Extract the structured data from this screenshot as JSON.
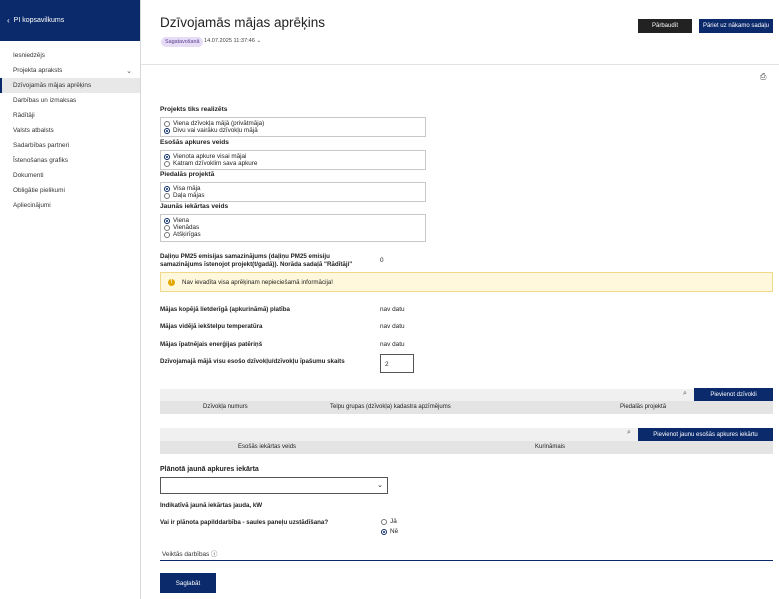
{
  "sidebar": {
    "back_label": "PI kopsavilkums",
    "items": [
      {
        "label": "Iesniedzējs"
      },
      {
        "label": "Projekta apraksts"
      },
      {
        "label": "Dzīvojamās mājas aprēķins"
      },
      {
        "label": "Darbības un izmaksas"
      },
      {
        "label": "Rādītāji"
      },
      {
        "label": "Valsts atbalsts"
      },
      {
        "label": "Sadarbības partneri"
      },
      {
        "label": "Īstenošanas grafiks"
      },
      {
        "label": "Dokumenti"
      },
      {
        "label": "Obligātie pielikumi"
      },
      {
        "label": "Apliecinājumi"
      }
    ],
    "active_index": 2
  },
  "header": {
    "title": "Dzīvojamās mājas aprēķins",
    "status_badge": "Sagatavošanā",
    "timestamp": "14.07.2025 11:37:46",
    "check_button": "Pārbaudīt",
    "next_button": "Pāriet uz nākamo sadaļu"
  },
  "sections": {
    "realization": {
      "title": "Projekts tiks realizēts",
      "options": [
        "Viena dzīvokļa mājā (privātmāja)",
        "Divu vai vairāku dzīvokļu mājā"
      ],
      "selected": 1
    },
    "heating": {
      "title": "Esošās apkures veids",
      "options": [
        "Vienota apkure visai mājai",
        "Katram dzīvoklim sava apkure"
      ],
      "selected": 0
    },
    "participation": {
      "title": "Piedalās projektā",
      "options": [
        "Visa māja",
        "Daļa mājas"
      ],
      "selected": 0
    },
    "new_device": {
      "title": "Jaunās iekārtas veids",
      "options": [
        "Viena",
        "Vienādas",
        "Atšķirīgas"
      ],
      "selected": 0
    }
  },
  "pm25": {
    "label_line1": "Daļiņu PM25 emisijas samazinājums (daļiņu PM25 emisiju",
    "label_line2": "samazinājums īstenojot projekt(t/gadā)). Norāda sadaļā \"Rādītāji\"",
    "value": "0"
  },
  "warning": {
    "text": "Nav ievadīta visa aprēķinam nepieciešamā informācija!"
  },
  "metrics": [
    {
      "label": "Mājas kopējā lietderīgā (apkurināmā) platība",
      "value": "nav datu"
    },
    {
      "label": "Mājas vidējā iekštelpu temperatūra",
      "value": "nav datu"
    },
    {
      "label": "Mājas īpatnējais enerģijas patēriņš",
      "value": "nav datu"
    }
  ],
  "owners": {
    "label": "Dzīvojamajā mājā visu esošo dzīvokļu/dzīvokļu īpašumu skaits",
    "value": "2"
  },
  "apartments_table": {
    "add_button": "Pievienot dzīvokli",
    "columns": [
      "Dzīvokļa numurs",
      "Telpu grupas (dzīvokļa) kadastra apzīmējums",
      "Piedalās projektā"
    ]
  },
  "heating_table": {
    "add_button": "Pievienot jaunu esošās apkures iekārtu",
    "columns": [
      "Esošās iekārtas veids",
      "Kurināmais"
    ]
  },
  "planned": {
    "title": "Plānotā jaunā apkures iekārta",
    "select_value": "",
    "power_label": "Indikatīvā jaunā iekārtas jauda, kW",
    "solar_question": "Vai ir plānota papilddarbība - saules paneļu uzstādīšana?",
    "yes": "Jā",
    "no": "Nē",
    "solar_selected": "no"
  },
  "works": {
    "label": "Veiktās darbības"
  },
  "footer": {
    "save_button": "Saglabāt"
  },
  "colors": {
    "navy": "#0b2a6b",
    "warning_bg": "#fff8dc",
    "badge_bg": "#e6dcf5"
  }
}
